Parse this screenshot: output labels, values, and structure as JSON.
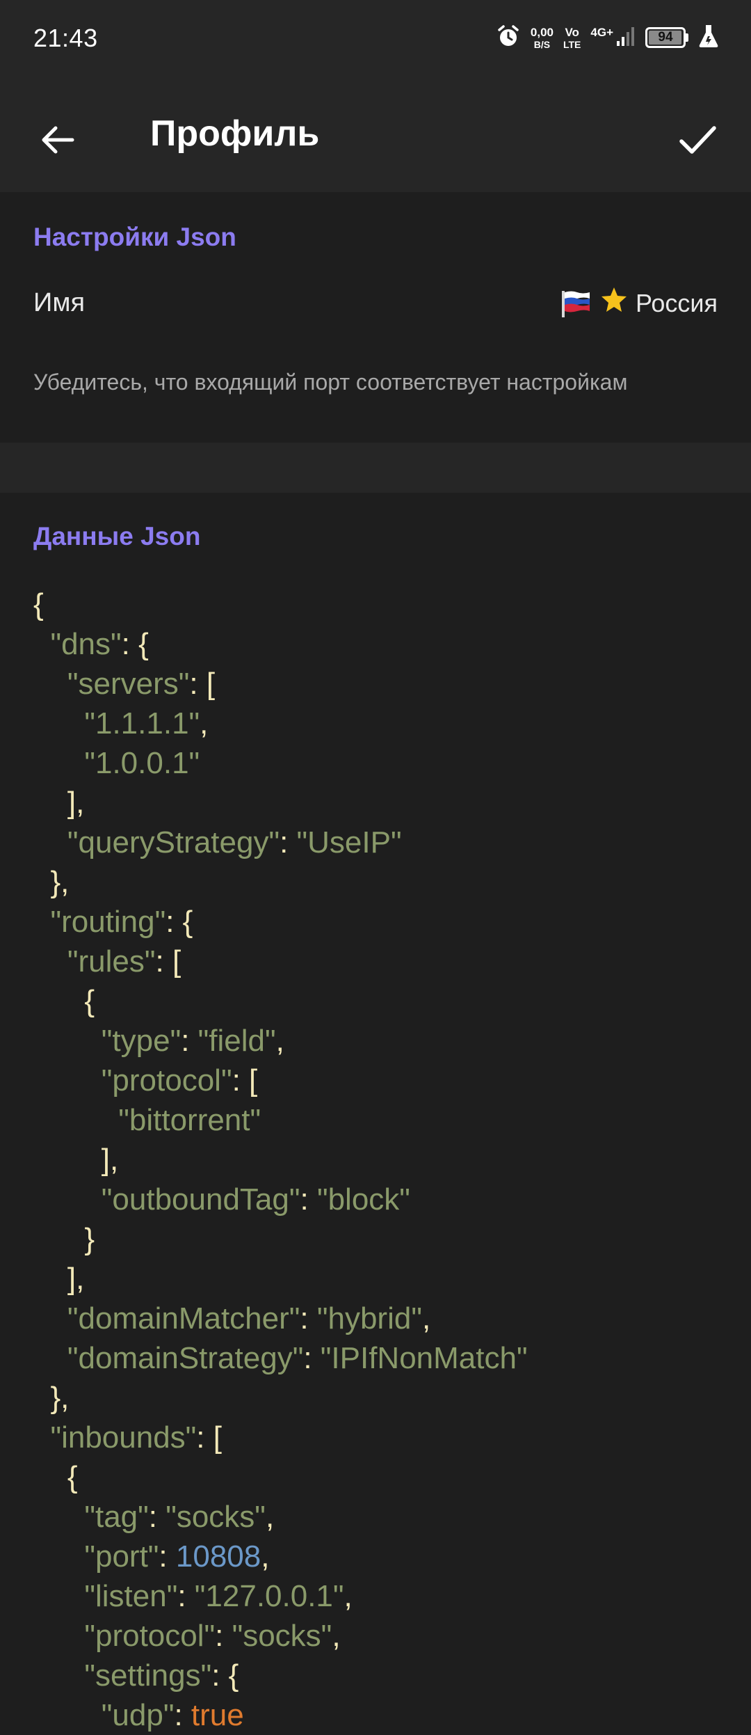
{
  "status_bar": {
    "time": "21:43",
    "net_speed_value": "0,00",
    "net_speed_unit": "B/S",
    "volte_top": "Vo",
    "volte_bottom": "LTE",
    "network_type": "4G+",
    "battery_level": "94"
  },
  "app_bar": {
    "title": "Профиль"
  },
  "json_settings": {
    "section_title": "Настройки Json",
    "name_label": "Имя",
    "name_value": "Россия",
    "helper_text": "Убедитесь, что входящий порт соответствует настройкам"
  },
  "json_data": {
    "section_title": "Данные Json",
    "lines": [
      [
        {
          "t": "p",
          "v": "{"
        }
      ],
      [
        {
          "t": "p",
          "v": "  "
        },
        {
          "t": "k",
          "v": "\"dns\""
        },
        {
          "t": "p",
          "v": ": {"
        }
      ],
      [
        {
          "t": "p",
          "v": "    "
        },
        {
          "t": "k",
          "v": "\"servers\""
        },
        {
          "t": "p",
          "v": ": ["
        }
      ],
      [
        {
          "t": "p",
          "v": "      "
        },
        {
          "t": "s",
          "v": "\"1.1.1.1\""
        },
        {
          "t": "p",
          "v": ","
        }
      ],
      [
        {
          "t": "p",
          "v": "      "
        },
        {
          "t": "s",
          "v": "\"1.0.0.1\""
        }
      ],
      [
        {
          "t": "p",
          "v": "    ],"
        }
      ],
      [
        {
          "t": "p",
          "v": "    "
        },
        {
          "t": "k",
          "v": "\"queryStrategy\""
        },
        {
          "t": "p",
          "v": ": "
        },
        {
          "t": "s",
          "v": "\"UseIP\""
        }
      ],
      [
        {
          "t": "p",
          "v": "  },"
        }
      ],
      [
        {
          "t": "p",
          "v": "  "
        },
        {
          "t": "k",
          "v": "\"routing\""
        },
        {
          "t": "p",
          "v": ": {"
        }
      ],
      [
        {
          "t": "p",
          "v": "    "
        },
        {
          "t": "k",
          "v": "\"rules\""
        },
        {
          "t": "p",
          "v": ": ["
        }
      ],
      [
        {
          "t": "p",
          "v": "      {"
        }
      ],
      [
        {
          "t": "p",
          "v": "        "
        },
        {
          "t": "k",
          "v": "\"type\""
        },
        {
          "t": "p",
          "v": ": "
        },
        {
          "t": "s",
          "v": "\"field\""
        },
        {
          "t": "p",
          "v": ","
        }
      ],
      [
        {
          "t": "p",
          "v": "        "
        },
        {
          "t": "k",
          "v": "\"protocol\""
        },
        {
          "t": "p",
          "v": ": ["
        }
      ],
      [
        {
          "t": "p",
          "v": "          "
        },
        {
          "t": "s",
          "v": "\"bittorrent\""
        }
      ],
      [
        {
          "t": "p",
          "v": "        ],"
        }
      ],
      [
        {
          "t": "p",
          "v": "        "
        },
        {
          "t": "k",
          "v": "\"outboundTag\""
        },
        {
          "t": "p",
          "v": ": "
        },
        {
          "t": "s",
          "v": "\"block\""
        }
      ],
      [
        {
          "t": "p",
          "v": "      }"
        }
      ],
      [
        {
          "t": "p",
          "v": "    ],"
        }
      ],
      [
        {
          "t": "p",
          "v": "    "
        },
        {
          "t": "k",
          "v": "\"domainMatcher\""
        },
        {
          "t": "p",
          "v": ": "
        },
        {
          "t": "s",
          "v": "\"hybrid\""
        },
        {
          "t": "p",
          "v": ","
        }
      ],
      [
        {
          "t": "p",
          "v": "    "
        },
        {
          "t": "k",
          "v": "\"domainStrategy\""
        },
        {
          "t": "p",
          "v": ": "
        },
        {
          "t": "s",
          "v": "\"IPIfNonMatch\""
        }
      ],
      [
        {
          "t": "p",
          "v": "  },"
        }
      ],
      [
        {
          "t": "p",
          "v": "  "
        },
        {
          "t": "k",
          "v": "\"inbounds\""
        },
        {
          "t": "p",
          "v": ": ["
        }
      ],
      [
        {
          "t": "p",
          "v": "    {"
        }
      ],
      [
        {
          "t": "p",
          "v": "      "
        },
        {
          "t": "k",
          "v": "\"tag\""
        },
        {
          "t": "p",
          "v": ": "
        },
        {
          "t": "s",
          "v": "\"socks\""
        },
        {
          "t": "p",
          "v": ","
        }
      ],
      [
        {
          "t": "p",
          "v": "      "
        },
        {
          "t": "k",
          "v": "\"port\""
        },
        {
          "t": "p",
          "v": ": "
        },
        {
          "t": "n",
          "v": "10808"
        },
        {
          "t": "p",
          "v": ","
        }
      ],
      [
        {
          "t": "p",
          "v": "      "
        },
        {
          "t": "k",
          "v": "\"listen\""
        },
        {
          "t": "p",
          "v": ": "
        },
        {
          "t": "s",
          "v": "\"127.0.0.1\""
        },
        {
          "t": "p",
          "v": ","
        }
      ],
      [
        {
          "t": "p",
          "v": "      "
        },
        {
          "t": "k",
          "v": "\"protocol\""
        },
        {
          "t": "p",
          "v": ": "
        },
        {
          "t": "s",
          "v": "\"socks\""
        },
        {
          "t": "p",
          "v": ","
        }
      ],
      [
        {
          "t": "p",
          "v": "      "
        },
        {
          "t": "k",
          "v": "\"settings\""
        },
        {
          "t": "p",
          "v": ": {"
        }
      ],
      [
        {
          "t": "p",
          "v": "        "
        },
        {
          "t": "k",
          "v": "\"udp\""
        },
        {
          "t": "p",
          "v": ": "
        },
        {
          "t": "b",
          "v": "true"
        }
      ]
    ]
  },
  "colors": {
    "accent": "#8c7cf0",
    "background": "#1e1e1e",
    "app_bar": "#262626",
    "json_key": "#8a9a6a",
    "json_string": "#8a9a6a",
    "json_number": "#6b98c8",
    "json_bool": "#e07b2e",
    "json_punctuation": "#f3e9b8"
  },
  "icons": {
    "back": "arrow-left-icon",
    "save": "check-icon",
    "alarm": "alarm-icon",
    "signal": "signal-icon",
    "battery": "battery-icon",
    "flask": "flask-icon",
    "flag": "russia-flag-icon",
    "star": "star-icon"
  }
}
